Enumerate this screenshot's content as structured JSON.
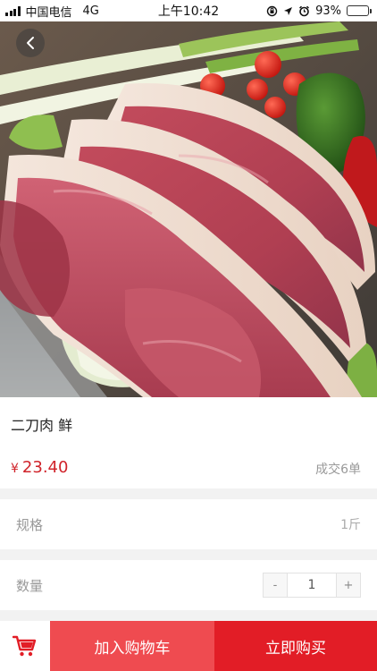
{
  "status_bar": {
    "carrier": "中国电信",
    "network": "4G",
    "time": "上午10:42",
    "battery": "93%",
    "battery_level": 0.93
  },
  "product": {
    "name": "二刀肉 鲜",
    "currency": "¥",
    "price": "23.40",
    "sold": "成交6单"
  },
  "spec": {
    "label": "规格",
    "value": "1斤"
  },
  "quantity": {
    "label": "数量",
    "minus": "-",
    "value": "1",
    "plus": "+"
  },
  "actions": {
    "add_to_cart": "加入购物车",
    "buy_now": "立即购买"
  },
  "colors": {
    "accent": "#e21d26",
    "add_cart_bg": "#ef4b50",
    "price": "#d0232a"
  }
}
